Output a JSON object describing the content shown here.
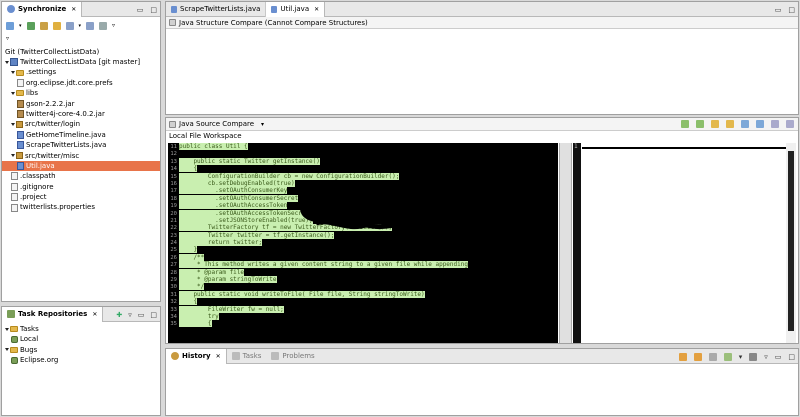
{
  "sync_view": {
    "title": "Synchronize",
    "repo_header": "Git (TwitterCollectListData)",
    "tree": [
      {
        "label": "TwitterCollectListData  [git master]",
        "icon": "project-icon",
        "depth": 0,
        "expanded": true
      },
      {
        "label": ".settings",
        "icon": "folder-icon",
        "depth": 1,
        "expanded": true
      },
      {
        "label": "org.eclipse.jdt.core.prefs",
        "icon": "text-file-icon",
        "depth": 2
      },
      {
        "label": "libs",
        "icon": "folder-icon",
        "depth": 1,
        "expanded": true
      },
      {
        "label": "gson-2.2.2.jar",
        "icon": "jar-icon",
        "depth": 2
      },
      {
        "label": "twitter4j-core-4.0.2.jar",
        "icon": "jar-icon",
        "depth": 2
      },
      {
        "label": "src/twitter/login",
        "icon": "package-icon",
        "depth": 1,
        "expanded": true
      },
      {
        "label": "GetHomeTimeline.java",
        "icon": "java-file-icon",
        "depth": 2
      },
      {
        "label": "ScrapeTwitterLists.java",
        "icon": "java-file-icon",
        "depth": 2
      },
      {
        "label": "src/twitter/misc",
        "icon": "package-icon",
        "depth": 1,
        "expanded": true
      },
      {
        "label": "Util.java",
        "icon": "java-file-icon",
        "depth": 2,
        "selected": true
      },
      {
        "label": ".classpath",
        "icon": "text-file-icon",
        "depth": 1
      },
      {
        "label": ".gitignore",
        "icon": "text-file-icon",
        "depth": 1
      },
      {
        "label": ".project",
        "icon": "text-file-icon",
        "depth": 1
      },
      {
        "label": "twitterlists.properties",
        "icon": "text-file-icon",
        "depth": 1
      }
    ]
  },
  "repo_view": {
    "title": "Task Repositories",
    "tree": [
      {
        "label": "Tasks",
        "depth": 0,
        "expanded": true
      },
      {
        "label": "Local",
        "depth": 1
      },
      {
        "label": "Bugs",
        "depth": 0,
        "expanded": true
      },
      {
        "label": "Eclipse.org",
        "depth": 1
      }
    ]
  },
  "editor": {
    "tabs": [
      {
        "label": "ScrapeTwitterLists.java",
        "active": false
      },
      {
        "label": "Util.java",
        "active": true
      }
    ],
    "structure_compare_title": "Java Structure Compare  (Cannot Compare Structures)",
    "source_compare_title": "Java Source Compare",
    "left_pane_label": "Local File Workspace",
    "code_lines": [
      {
        "n": "11",
        "text": "public class Util {"
      },
      {
        "n": "12",
        "text": ""
      },
      {
        "n": "13",
        "text": "    public static Twitter getInstance()"
      },
      {
        "n": "14",
        "text": "    {"
      },
      {
        "n": "15",
        "text": "        ConfigurationBuilder cb = new ConfigurationBuilder();"
      },
      {
        "n": "16",
        "text": "        cb.setDebugEnabled(true)"
      },
      {
        "n": "17",
        "text": "          .setOAuthConsumerKey"
      },
      {
        "n": "18",
        "text": "          .setOAuthConsumerSecret"
      },
      {
        "n": "19",
        "text": "          .setOAuthAccessToken"
      },
      {
        "n": "20",
        "text": "          .setOAuthAccessTokenSecret"
      },
      {
        "n": "21",
        "text": "          .setJSONStoreEnabled(true);"
      },
      {
        "n": "22",
        "text": "        TwitterFactory tf = new TwitterFactory(cb.build());"
      },
      {
        "n": "23",
        "text": "        Twitter twitter = tf.getInstance();"
      },
      {
        "n": "24",
        "text": "        return twitter;"
      },
      {
        "n": "25",
        "text": "    }"
      },
      {
        "n": "26",
        "text": "    /**"
      },
      {
        "n": "27",
        "text": "     * This method writes a given content string to a given file while appending"
      },
      {
        "n": "28",
        "text": "     * @param file"
      },
      {
        "n": "29",
        "text": "     * @param stringToWrite"
      },
      {
        "n": "30",
        "text": "     */"
      },
      {
        "n": "31",
        "text": "    public static void writeToFile( File file, String stringToWrite)"
      },
      {
        "n": "32",
        "text": "    {"
      },
      {
        "n": "33",
        "text": "        FileWriter fw = null;"
      },
      {
        "n": "34",
        "text": "        try"
      },
      {
        "n": "35",
        "text": "        {"
      }
    ],
    "right_line_number": "1"
  },
  "bottom_panel": {
    "tabs": [
      {
        "label": "History",
        "active": true
      },
      {
        "label": "Tasks",
        "active": false
      },
      {
        "label": "Problems",
        "active": false
      }
    ]
  },
  "colors": {
    "selection": "#e8744a",
    "added_background": "#c9efb0",
    "code_background": "#000000"
  }
}
